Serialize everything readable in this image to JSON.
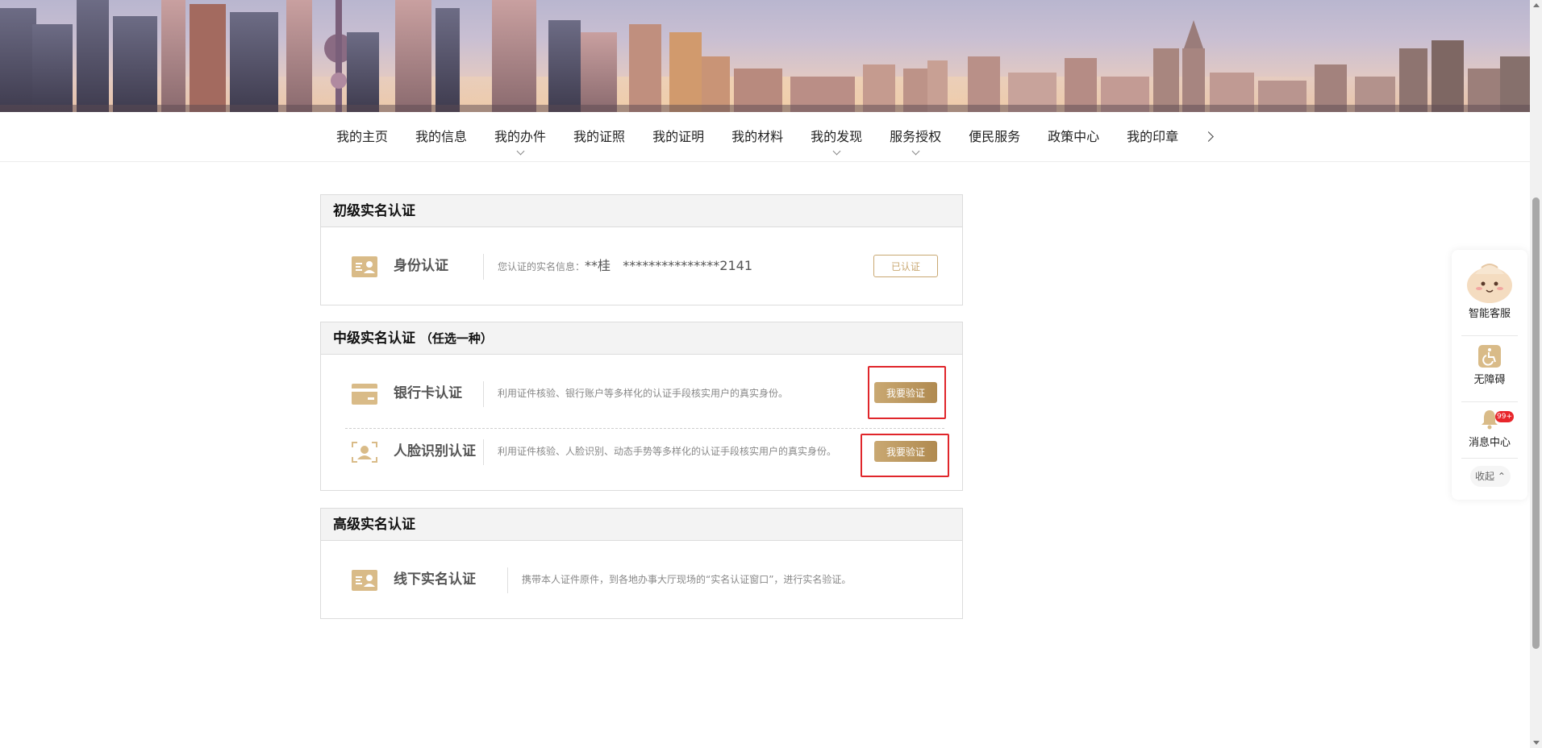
{
  "nav": {
    "items": [
      {
        "label": "我的主页",
        "dropdown": false
      },
      {
        "label": "我的信息",
        "dropdown": false
      },
      {
        "label": "我的办件",
        "dropdown": true
      },
      {
        "label": "我的证照",
        "dropdown": false
      },
      {
        "label": "我的证明",
        "dropdown": false
      },
      {
        "label": "我的材料",
        "dropdown": false
      },
      {
        "label": "我的发现",
        "dropdown": true
      },
      {
        "label": "服务授权",
        "dropdown": true
      },
      {
        "label": "便民服务",
        "dropdown": false
      },
      {
        "label": "政策中心",
        "dropdown": false
      },
      {
        "label": "我的印章",
        "dropdown": false
      }
    ]
  },
  "primary": {
    "title": "初级实名认证",
    "row": {
      "title": "身份认证",
      "desc_prefix": "您认证的实名信息：",
      "name": "**桂",
      "id_number": "***************2141",
      "status_label": "已认证"
    }
  },
  "intermediate": {
    "title": "中级实名认证",
    "subtitle": "（任选一种）",
    "bank": {
      "title": "银行卡认证",
      "desc": "利用证件核验、银行账户等多样化的认证手段核实用户的真实身份。",
      "button": "我要验证"
    },
    "face": {
      "title": "人脸识别认证",
      "desc": "利用证件核验、人脸识别、动态手势等多样化的认证手段核实用户的真实身份。",
      "button": "我要验证"
    }
  },
  "advanced": {
    "title": "高级实名认证",
    "row": {
      "title": "线下实名认证",
      "desc": "携带本人证件原件，到各地办事大厅现场的“实名认证窗口”，进行实名验证。"
    }
  },
  "float_panel": {
    "assistant": "智能客服",
    "accessibility": "无障碍",
    "messages": "消息中心",
    "messages_badge": "99+",
    "collapse": "收起"
  },
  "colors": {
    "gold": "#c9a872",
    "highlight_red": "#e0262b",
    "badge_red": "#e8262b"
  }
}
